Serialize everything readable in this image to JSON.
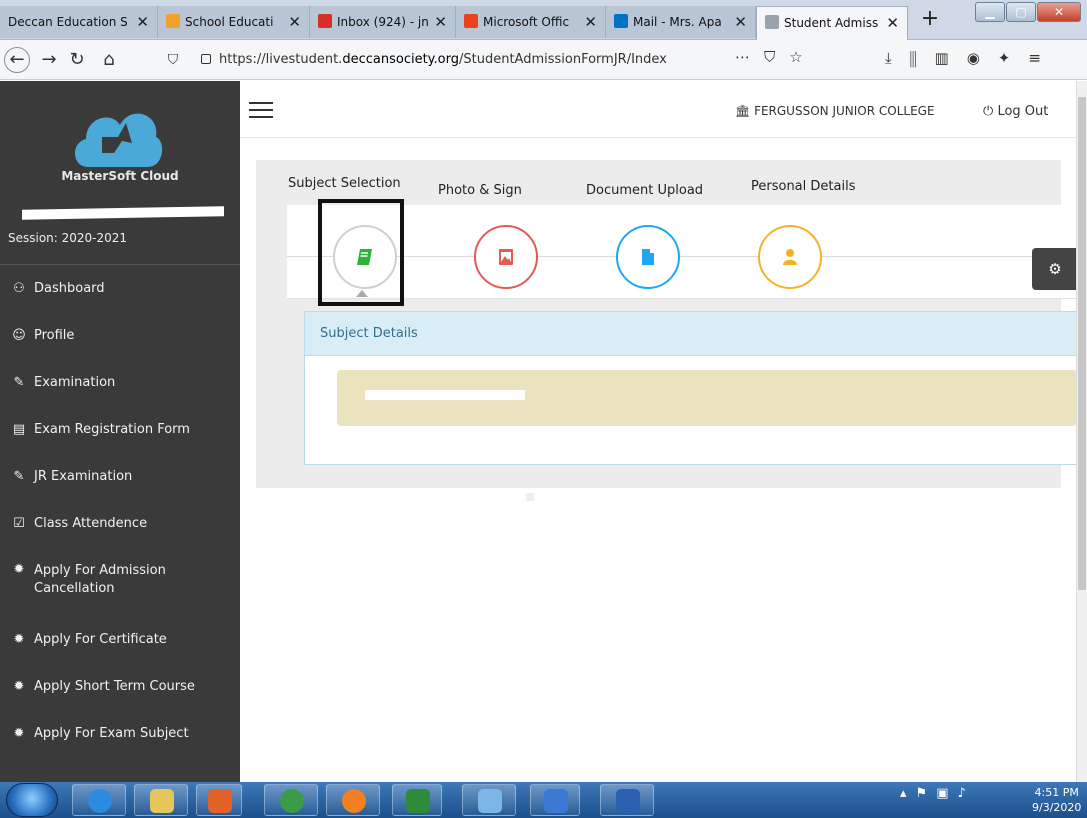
{
  "browser": {
    "tabs": [
      {
        "label": "Deccan Education S",
        "close": "✕",
        "favicon_color": "#e8e8e8"
      },
      {
        "label": "School Educati",
        "close": "✕",
        "favicon_color": "#f0a22b"
      },
      {
        "label": "Inbox (924) - jn",
        "close": "✕",
        "favicon_color": "#d93025"
      },
      {
        "label": "Microsoft Offic",
        "close": "✕",
        "favicon_color": "#e8431b"
      },
      {
        "label": "Mail - Mrs. Apa",
        "close": "✕",
        "favicon_color": "#0072c6"
      },
      {
        "label": "Student Admiss",
        "close": "✕",
        "favicon_color": "#9aa3ad"
      }
    ],
    "new_tab": "+",
    "url_prefix": "https://livestudent.",
    "url_domain": "deccansociety.org",
    "url_path": "/StudentAdmissionFormJR/Index"
  },
  "sidebar": {
    "brand": "MasterSoft Cloud",
    "session": "Session: 2020-2021",
    "items": [
      {
        "label": "Dashboard",
        "icon": "dashboard-icon",
        "glyph": "⚇"
      },
      {
        "label": "Profile",
        "icon": "profile-icon",
        "glyph": "☺"
      },
      {
        "label": "Examination",
        "icon": "pencil-icon",
        "glyph": "✎"
      },
      {
        "label": "Exam Registration Form",
        "icon": "pdf-file-icon",
        "glyph": "▤"
      },
      {
        "label": "JR Examination",
        "icon": "pencil-icon",
        "glyph": "✎"
      },
      {
        "label": "Class Attendence",
        "icon": "checkbox-icon",
        "glyph": "☑"
      },
      {
        "label": "Apply For Admission Cancellation",
        "icon": "certificate-icon",
        "glyph": "✹"
      },
      {
        "label": "Apply For Certificate",
        "icon": "certificate-icon",
        "glyph": "✹"
      },
      {
        "label": "Apply Short Term Course",
        "icon": "certificate-icon",
        "glyph": "✹"
      },
      {
        "label": "Apply For Exam Subject",
        "icon": "certificate-icon",
        "glyph": "✹"
      }
    ]
  },
  "header": {
    "college": "FERGUSSON JUNIOR COLLEGE",
    "logout": "Log Out"
  },
  "wizard": {
    "steps": [
      {
        "label": "Subject Selection",
        "color": "#2bb33a"
      },
      {
        "label": "Photo & Sign",
        "color": "#e25b54"
      },
      {
        "label": "Document Upload",
        "color": "#1ea7f3"
      },
      {
        "label": "Personal Details",
        "color": "#f5b323"
      }
    ],
    "active_step": 0
  },
  "subject_card": {
    "title": "Subject Details"
  },
  "taskbar": {
    "time": "4:51 PM",
    "date": "9/3/2020"
  }
}
